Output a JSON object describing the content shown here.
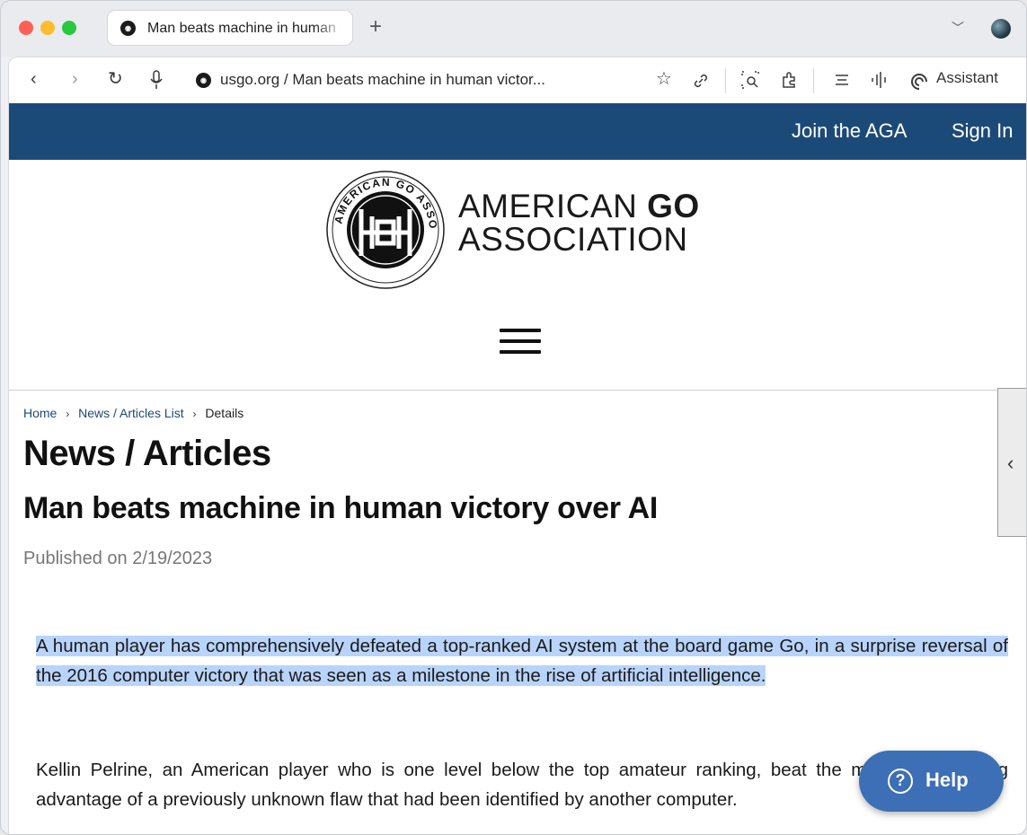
{
  "browser": {
    "tab": {
      "title": "Man beats machine in human victory over AI",
      "favicon": "aga-seal-icon"
    },
    "new_tab_symbol": "+",
    "url": "usgo.org / Man beats machine in human victor...",
    "assistant_label": "Assistant",
    "icons": [
      "back-icon",
      "forward-icon",
      "reload-icon",
      "mic-icon",
      "star-icon",
      "link-icon",
      "lens-icon",
      "extensions-icon",
      "reader-icon",
      "audio-icon",
      "assistant-icon"
    ]
  },
  "site": {
    "header_links": {
      "join": "Join the AGA",
      "sign_in": "Sign In"
    },
    "header_color": "#1c4a78",
    "logo": {
      "line1_prefix": "AMERICAN ",
      "line1_bold": "GO",
      "line2": "ASSOCIATION",
      "seal_text": "AMERICAN GO ASSOCIATION"
    }
  },
  "breadcrumb": {
    "home": "Home",
    "list": "News / Articles List",
    "current": "Details"
  },
  "article": {
    "section_heading": "News / Articles",
    "title": "Man beats machine in human victory over AI",
    "published": "Published on 2/19/2023",
    "paragraph1": "A human player has comprehensively defeated a top-ranked AI system at the board game Go, in a surprise reversal of the 2016 computer victory that was seen as a milestone in the rise of artificial intelligence.",
    "paragraph2": "Kellin Pelrine, an American player who is one level below the top amateur ranking, beat the machine by taking advantage of a previously unknown flaw that had been identified by another computer."
  },
  "help_button": {
    "label": "Help",
    "symbol": "?"
  },
  "highlight_color": "#b9d4fb"
}
